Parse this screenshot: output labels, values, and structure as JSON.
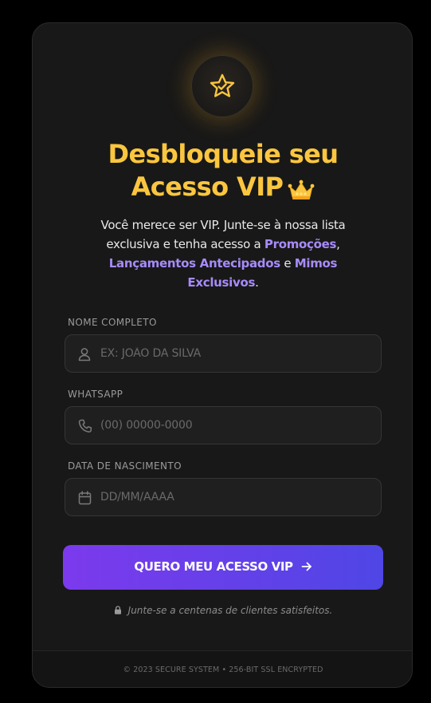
{
  "hero": {
    "badge_icon": "star-badge-icon",
    "title_line1": "Desbloqueie seu",
    "title_line2": "Acesso VIP",
    "title_emoji_icon": "crown-icon",
    "description_part1": "Você merece ser VIP. Junte-se à nossa lista exclusiva e tenha acesso a ",
    "highlight1": "Promoções",
    "separator": ", ",
    "highlight2": "Lançamentos Antecipados",
    "connector": " e ",
    "highlight3": "Mimos Exclusivos",
    "end": "."
  },
  "form": {
    "name": {
      "label": "NOME COMPLETO",
      "placeholder": "EX: JOÃO DA SILVA",
      "value": "",
      "icon": "user-icon"
    },
    "whatsapp": {
      "label": "WHATSAPP",
      "placeholder": "(00) 00000-0000",
      "value": "",
      "icon": "phone-icon"
    },
    "birthdate": {
      "label": "DATA DE NASCIMENTO",
      "placeholder": "DD/MM/AAAA",
      "value": "",
      "icon": "calendar-icon"
    },
    "submit_label": "QUERO MEU ACESSO VIP",
    "submit_icon": "arrow-right-icon"
  },
  "social_proof": {
    "icon": "lock-icon",
    "text": "Junte-se a centenas de clientes satisfeitos."
  },
  "footer": {
    "text": "© 2023 SECURE SYSTEM • 256-BIT SSL ENCRYPTED"
  },
  "colors": {
    "accent_gold": "#fbc63f",
    "highlight_purple": "#a78bfa",
    "cta_gradient_start": "#7c3aed",
    "cta_gradient_end": "#4f46e5",
    "card_bg": "#181818",
    "page_bg": "#000000"
  }
}
